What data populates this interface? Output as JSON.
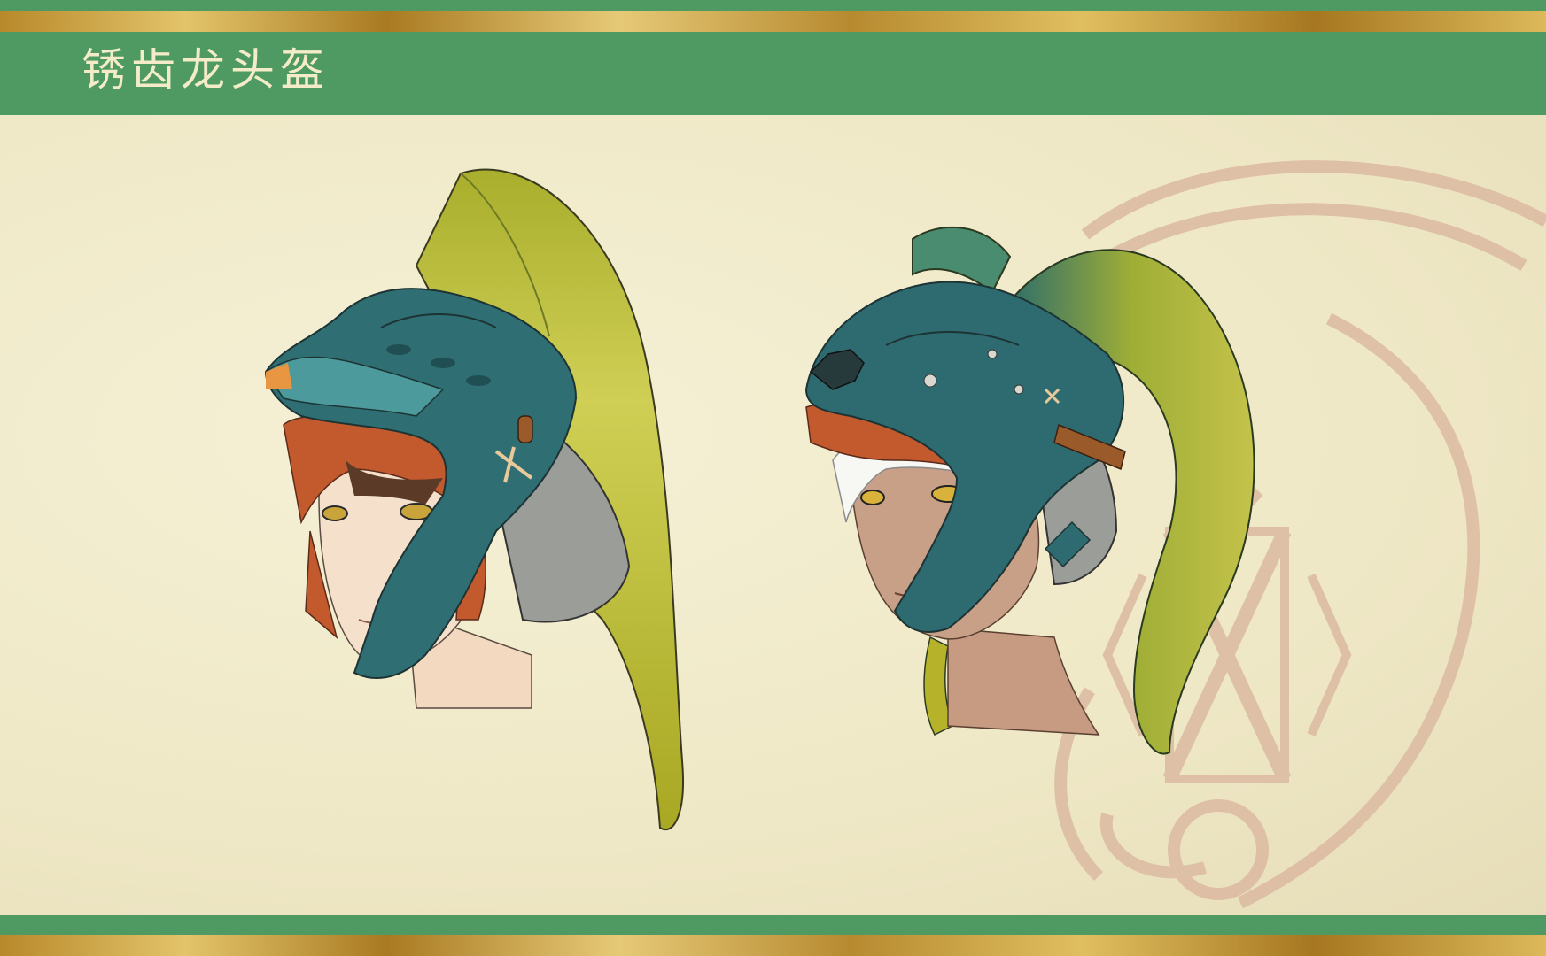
{
  "header": {
    "title": "锈齿龙头盔"
  },
  "colors": {
    "frame_green": "#4f9a63",
    "gold": "#d9b85a",
    "paper": "#f1eccc",
    "helmet_teal": "#2e6f72",
    "fin_yellow": "#b2b42a",
    "hair_orange": "#c2562a",
    "emblem": "#d9b8a0"
  },
  "figures": [
    {
      "name": "female-head-helmet",
      "skin": "light"
    },
    {
      "name": "male-head-helmet",
      "skin": "tan",
      "hair": "white"
    }
  ]
}
